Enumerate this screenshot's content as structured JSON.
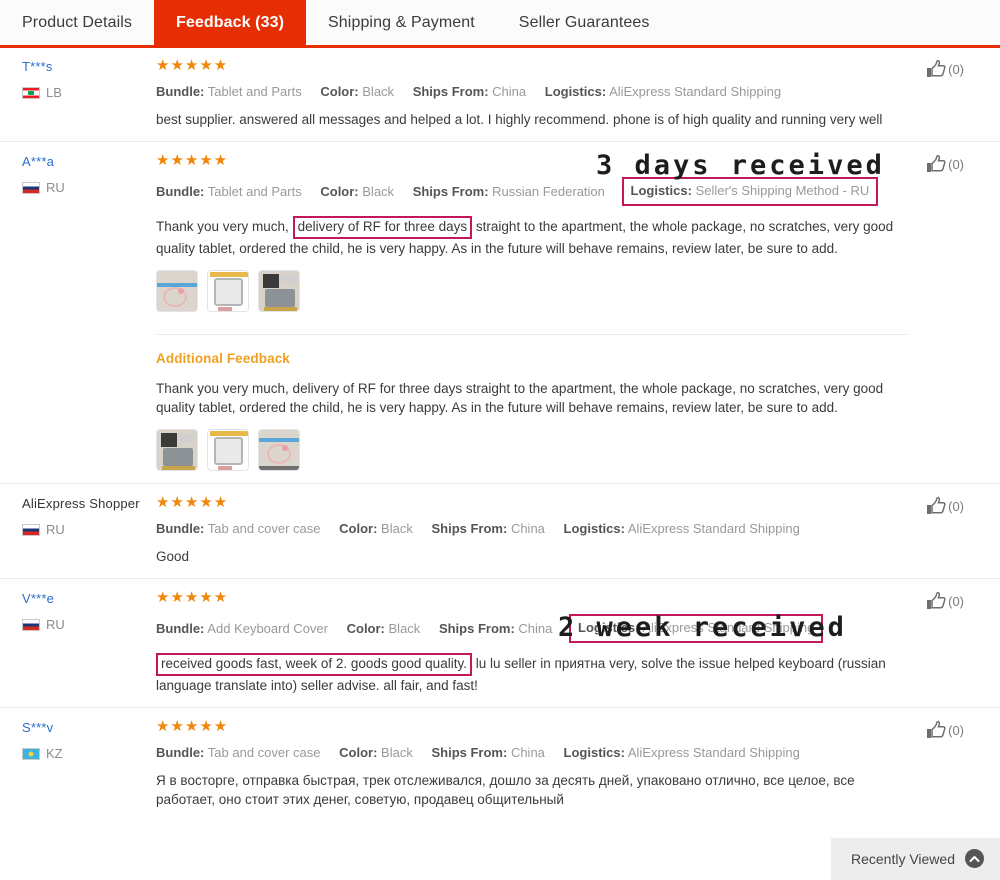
{
  "tabs": [
    {
      "label": "Product Details",
      "active": false
    },
    {
      "label": "Feedback (33)",
      "active": true
    },
    {
      "label": "Shipping & Payment",
      "active": false
    },
    {
      "label": "Seller Guarantees",
      "active": false
    }
  ],
  "labels": {
    "bundle": "Bundle:",
    "color": "Color:",
    "ships_from": "Ships From:",
    "logistics": "Logistics:",
    "additional_feedback": "Additional Feedback",
    "helpful_count": "(0)",
    "stars": "★★★★★"
  },
  "annotations": [
    {
      "text": "3 days received"
    },
    {
      "text": "2 week received"
    }
  ],
  "colors": {
    "tab_active_bg": "#e62e04",
    "star": "#f0860a",
    "highlight_border": "#c2185b",
    "additional_title": "#f0a021",
    "reviewer_link": "#2c6ecb"
  },
  "reviews": [
    {
      "name": "T***s",
      "country_code": "LB",
      "rating": 5,
      "bundle": "Tablet and Parts",
      "color": "Black",
      "ships_from": "China",
      "logistics": "AliExpress Standard Shipping",
      "text": "best supplier. answered all messages and helped a lot. I highly recommend. phone is of high quality and running very well",
      "helpful": "(0)"
    },
    {
      "name": "A***a",
      "country_code": "RU",
      "rating": 5,
      "bundle": "Tablet and Parts",
      "color": "Black",
      "ships_from": "Russian Federation",
      "logistics": "Seller's Shipping Method - RU",
      "text_pre": "Thank you very much,",
      "text_hl": "delivery of RF for three days",
      "text_post": "straight to the apartment, the whole package, no scratches, very good quality tablet, ordered the child, he is very happy. As in the future will behave remains, review later, be sure to add.",
      "helpful": "(0)",
      "additional_text": "Thank you very much, delivery of RF for three days straight to the apartment, the whole package, no scratches, very good quality tablet, ordered the child, he is very happy. As in the future will behave remains, review later, be sure to add."
    },
    {
      "name": "AliExpress Shopper",
      "country_code": "RU",
      "rating": 5,
      "bundle": "Tab and cover case",
      "color": "Black",
      "ships_from": "China",
      "logistics": "AliExpress Standard Shipping",
      "text": "Good",
      "helpful": "(0)"
    },
    {
      "name": "V***e",
      "country_code": "RU",
      "rating": 5,
      "bundle": "Add Keyboard Cover",
      "color": "Black",
      "ships_from": "China",
      "logistics": "AliExpress Standard Shipping",
      "text_hl": "received goods fast, week of 2. goods good quality.",
      "text_post": "lu lu seller in приятна very, solve the issue helped keyboard (russian language translate into) seller advise. all fair, and fast!",
      "helpful": "(0)"
    },
    {
      "name": "S***v",
      "country_code": "KZ",
      "rating": 5,
      "bundle": "Tab and cover case",
      "color": "Black",
      "ships_from": "China",
      "logistics": "AliExpress Standard Shipping",
      "text": "Я в восторге, отправка быстрая, трек отслеживался, дошло за десять дней, упаковано отлично, все целое, все работает, оно стоит этих денег, советую, продавец общительный",
      "helpful": "(0)"
    }
  ],
  "recently_viewed": {
    "label": "Recently Viewed",
    "icon": "chevron-up-icon"
  }
}
